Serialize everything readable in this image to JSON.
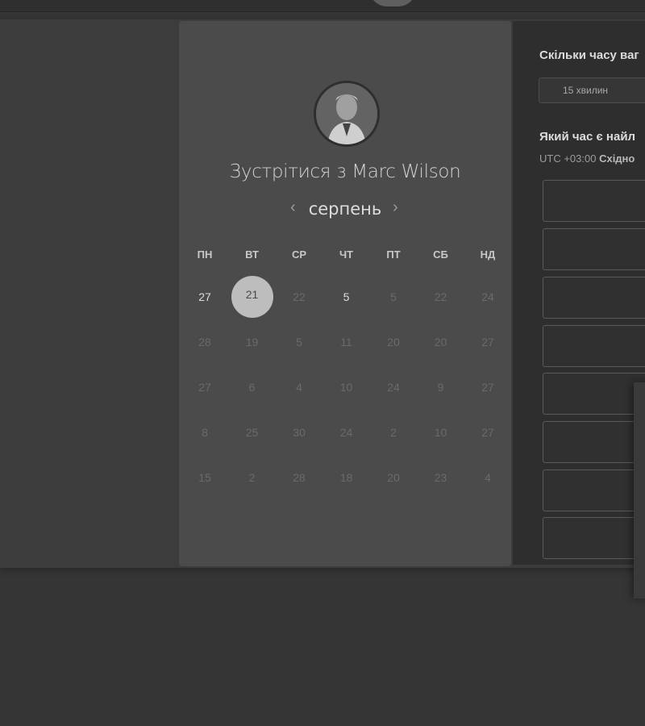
{
  "header": {
    "logo_icon": "chat-bubble-icon"
  },
  "calendar": {
    "avatar_icon": "user-avatar",
    "title": "Зустрітися з Marc Wilson",
    "month": "серпень",
    "prev_icon": "‹",
    "next_icon": "›",
    "weekdays": [
      "ПН",
      "ВТ",
      "СР",
      "ЧТ",
      "ПТ",
      "СБ",
      "НД"
    ],
    "weeks": [
      [
        "27",
        "21",
        "22",
        "5",
        "5",
        "22",
        "24"
      ],
      [
        "28",
        "19",
        "5",
        "11",
        "20",
        "20",
        "27"
      ],
      [
        "27",
        "6",
        "4",
        "10",
        "24",
        "9",
        "27"
      ],
      [
        "8",
        "25",
        "30",
        "24",
        "2",
        "10",
        "27"
      ],
      [
        "15",
        "2",
        "28",
        "18",
        "20",
        "23",
        "4"
      ]
    ],
    "selected": "21",
    "available": [
      "27",
      "5"
    ]
  },
  "scheduler": {
    "duration_question": "Скільки часу ваг",
    "duration_option": "15 хвилин",
    "time_question": "Який час є найл",
    "timezone_prefix": "UTC +03:00",
    "timezone_name": "Східно"
  },
  "colors": {
    "background": "#353535",
    "card": "#4b4b4b",
    "panel": "#2e2e2e",
    "selected_day": "#bdbdbd"
  }
}
